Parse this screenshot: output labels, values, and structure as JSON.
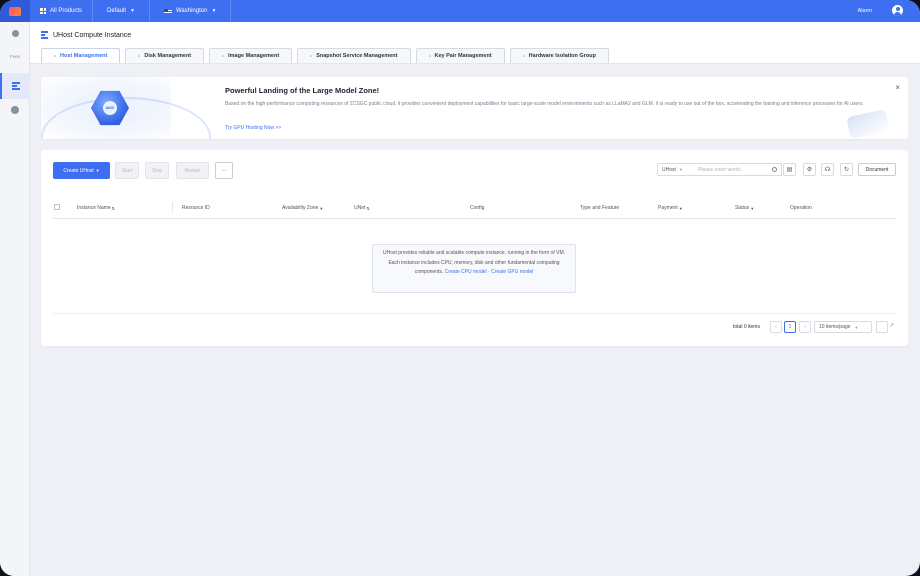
{
  "topbar": {
    "all_products": "All Products",
    "project": "Default",
    "region": "Washington",
    "alarm": "Alarm"
  },
  "sidebar": {
    "items": [
      {
        "label": ""
      },
      {
        "label": "Fees"
      },
      {
        "label": ""
      },
      {
        "label": ""
      }
    ]
  },
  "page": {
    "title": "UHost Compute Instance",
    "tabs": [
      {
        "label": "Host Management"
      },
      {
        "label": "Disk Management"
      },
      {
        "label": "Image Management"
      },
      {
        "label": "Snapshot Service Management"
      },
      {
        "label": "Key Pair Management"
      },
      {
        "label": "Hardware Isolation Group"
      }
    ]
  },
  "banner": {
    "badge": "AIGC",
    "title": "Powerful Landing of the Large Model Zone!",
    "description": "Based on the high-performance computing resources of ZCSGC public cloud, it provides convenient deployment capabilities for basic large-scale model environments such as LLaMA2 and GLM. It is ready to use out of the box, accelerating the training and inference processes for AI users.",
    "link": "Try GPU Hosting Now >>",
    "close": "×"
  },
  "toolbar": {
    "create": "Create UHost",
    "start": "Start",
    "stop": "Stop",
    "restart": "Restart",
    "more": "···",
    "filter_select": "UHost",
    "search_placeholder": "Please enter words",
    "document": "Document"
  },
  "table": {
    "columns": [
      "Instance Name",
      "Resource ID",
      "Availability Zone",
      "UNet",
      "Config",
      "Type and Feature",
      "Payment",
      "Status",
      "Operation"
    ],
    "empty_text": "UHost provides reliable and scalable compute instance, running in the form of VM. Each instance includes CPU, memory, disk and other fundamental computing components.",
    "empty_link_cpu": "Create CPU model",
    "empty_link_gpu": "Create GPU model"
  },
  "pagination": {
    "total": "total 0 items",
    "current_page": "1",
    "page_size": "10 items/page"
  }
}
